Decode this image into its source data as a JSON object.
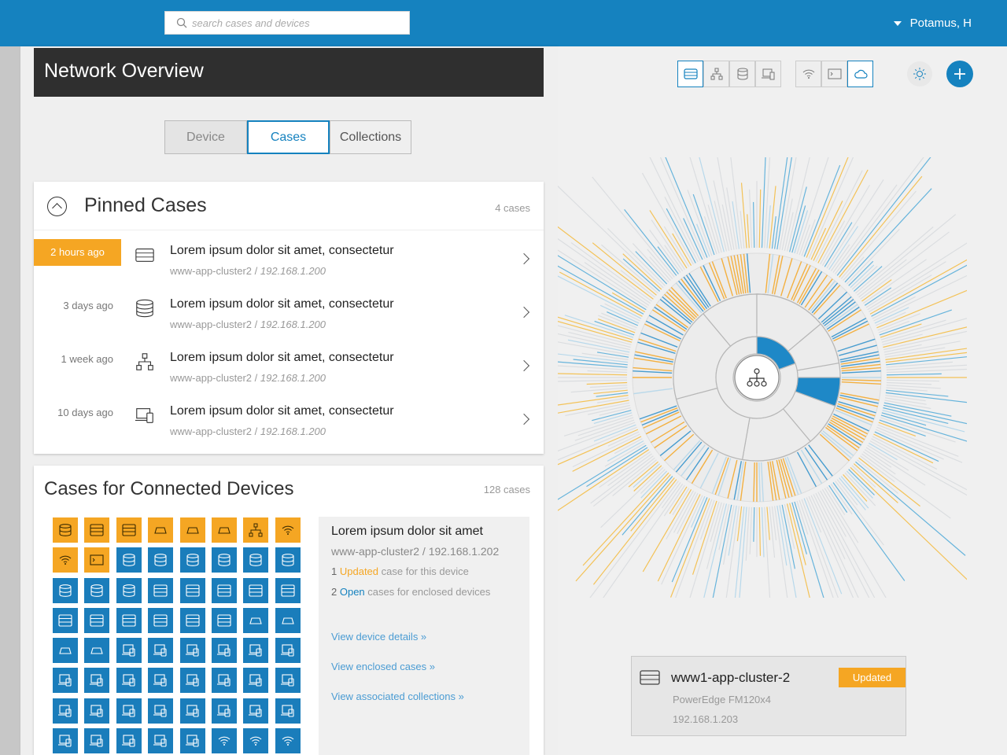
{
  "header": {
    "search_placeholder": "search cases and devices",
    "user_name": "Potamus, H"
  },
  "left": {
    "page_title": "Network Overview",
    "tabs": [
      {
        "label": "Device",
        "active": false
      },
      {
        "label": "Cases",
        "active": true
      },
      {
        "label": "Collections",
        "active": false
      }
    ],
    "pinned": {
      "title": "Pinned Cases",
      "count": "4 cases",
      "items": [
        {
          "time": "2 hours ago",
          "highlight": true,
          "icon": "server-icon",
          "title": "Lorem ipsum dolor sit amet, consectetur",
          "cluster": "www-app-cluster2 / ",
          "ip": "192.168.1.200"
        },
        {
          "time": "3 days ago",
          "highlight": false,
          "icon": "database-icon",
          "title": "Lorem ipsum dolor sit amet, consectetur",
          "cluster": "www-app-cluster2 / ",
          "ip": "192.168.1.200"
        },
        {
          "time": "1 week ago",
          "highlight": false,
          "icon": "network-icon",
          "title": "Lorem ipsum dolor sit amet, consectetur",
          "cluster": "www-app-cluster2 / ",
          "ip": "192.168.1.200"
        },
        {
          "time": "10 days ago",
          "highlight": false,
          "icon": "devices-icon",
          "title": "Lorem ipsum dolor sit amet, consectetur",
          "cluster": "www-app-cluster2 / ",
          "ip": "192.168.1.200"
        }
      ]
    },
    "connected": {
      "title": "Cases for Connected Devices",
      "count": "128 cases",
      "detail": {
        "title": "Lorem ipsum dolor sit amet",
        "subtitle": "www-app-cluster2 / 192.168.1.202",
        "line1_count": "1",
        "line1_status": "Updated",
        "line1_rest": "case for this device",
        "line2_count": "2",
        "line2_status": "Open",
        "line2_rest": "cases for enclosed devices",
        "link1": "View device details »",
        "link2": "View enclosed cases »",
        "link3": "View associated collections »"
      }
    }
  },
  "right": {
    "device_card": {
      "name": "www1-app-cluster-2",
      "badge": "Updated",
      "model": "PowerEdge FM120x4",
      "ip": "192.168.1.203"
    }
  },
  "colors": {
    "accent": "#1582bf",
    "orange": "#f5a623",
    "tile_blue": "#1a7dbb"
  }
}
